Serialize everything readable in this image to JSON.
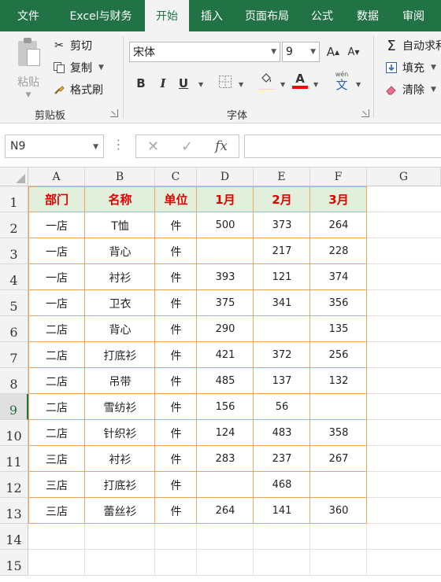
{
  "tabs": [
    "文件",
    "Excel与财务",
    "开始",
    "插入",
    "页面布局",
    "公式",
    "数据",
    "审阅"
  ],
  "active_tab": 2,
  "clipboard": {
    "paste": "粘贴",
    "cut": "剪切",
    "copy": "复制",
    "format_painter": "格式刷",
    "group_label": "剪贴板"
  },
  "font": {
    "name": "宋体",
    "size": "9",
    "bold": "B",
    "italic": "I",
    "underline": "U",
    "grow": "A",
    "shrink": "A",
    "font_color": "A",
    "phonetic_top": "wén",
    "phonetic_bottom": "文",
    "group_label": "字体",
    "fill_color": "#ffff00",
    "text_color": "#ff0000"
  },
  "editing": {
    "autosum": "自动求和",
    "fill": "填充",
    "clear": "清除"
  },
  "name_box": "N9",
  "formula_value": "",
  "columns": [
    "A",
    "B",
    "C",
    "D",
    "E",
    "F",
    "G"
  ],
  "row_numbers": [
    "1",
    "2",
    "3",
    "4",
    "5",
    "6",
    "7",
    "8",
    "9",
    "10",
    "11",
    "12",
    "13",
    "14",
    "15"
  ],
  "selected_row": 9,
  "table": {
    "header": [
      "部门",
      "名称",
      "单位",
      "1月",
      "2月",
      "3月"
    ],
    "rows": [
      [
        "一店",
        "T恤",
        "件",
        "500",
        "373",
        "264"
      ],
      [
        "一店",
        "背心",
        "件",
        "",
        "217",
        "228"
      ],
      [
        "一店",
        "衬衫",
        "件",
        "393",
        "121",
        "374"
      ],
      [
        "一店",
        "卫衣",
        "件",
        "375",
        "341",
        "356"
      ],
      [
        "二店",
        "背心",
        "件",
        "290",
        "",
        "135"
      ],
      [
        "二店",
        "打底衫",
        "件",
        "421",
        "372",
        "256"
      ],
      [
        "二店",
        "吊带",
        "件",
        "485",
        "137",
        "132"
      ],
      [
        "二店",
        "雪纺衫",
        "件",
        "156",
        "56",
        ""
      ],
      [
        "二店",
        "针织衫",
        "件",
        "124",
        "483",
        "358"
      ],
      [
        "三店",
        "衬衫",
        "件",
        "283",
        "237",
        "267"
      ],
      [
        "三店",
        "打底衫",
        "件",
        "",
        "468",
        ""
      ],
      [
        "三店",
        "蕾丝衫",
        "件",
        "264",
        "141",
        "360"
      ]
    ]
  },
  "colors": {
    "brand": "#217346",
    "header_fill": "#e2efda",
    "header_text": "#e00000",
    "table_border": "#f0a35e"
  }
}
